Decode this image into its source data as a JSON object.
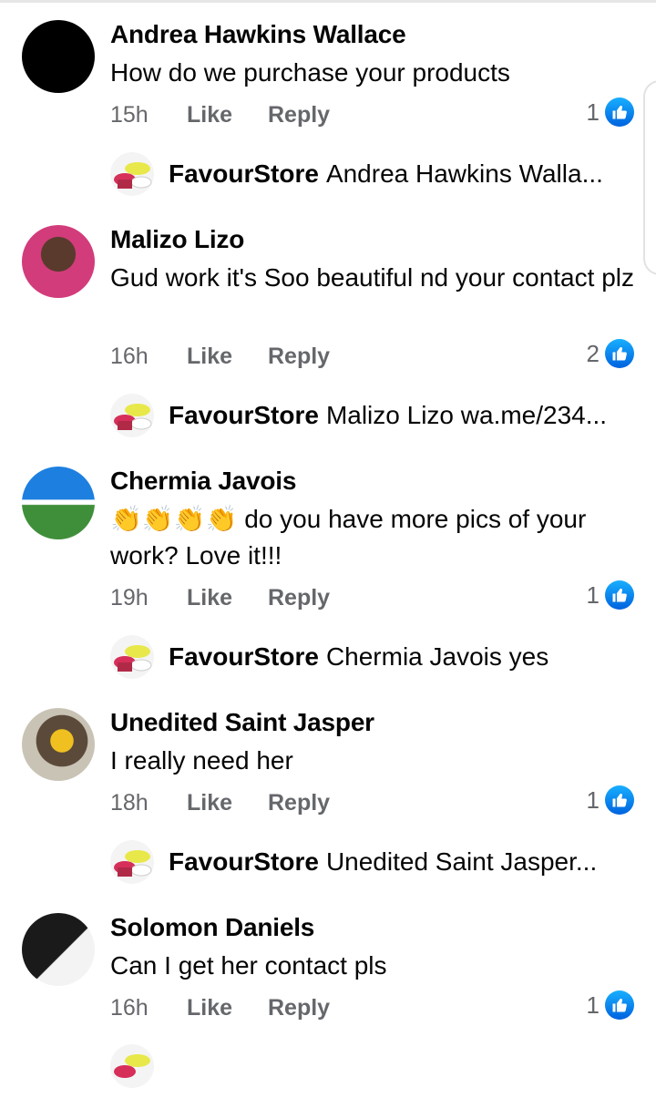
{
  "comments": [
    {
      "author": "Andrea Hawkins Wallace",
      "text": "How do we purchase your products",
      "time": "15h",
      "like": "Like",
      "reply": "Reply",
      "reactions": "1",
      "reply_author": "FavourStore",
      "reply_text": "Andrea Hawkins Walla..."
    },
    {
      "author": "Malizo Lizo",
      "text": "Gud work it's Soo beautiful nd your contact plz",
      "time": "16h",
      "like": "Like",
      "reply": "Reply",
      "reactions": "2",
      "reply_author": "FavourStore",
      "reply_text": "Malizo Lizo wa.me/234..."
    },
    {
      "author": "Chermia Javois",
      "text": "👏👏👏👏 do you have more pics of your work? Love it!!!",
      "time": "19h",
      "like": "Like",
      "reply": "Reply",
      "reactions": "1",
      "reply_author": "FavourStore",
      "reply_text": "Chermia Javois yes"
    },
    {
      "author": "Unedited Saint Jasper",
      "text": "I really need her",
      "time": "18h",
      "like": "Like",
      "reply": "Reply",
      "reactions": "1",
      "reply_author": "FavourStore",
      "reply_text": "Unedited Saint Jasper..."
    },
    {
      "author": "Solomon Daniels",
      "text": "Can I get her contact pls",
      "time": "16h",
      "like": "Like",
      "reply": "Reply",
      "reactions": "1"
    }
  ],
  "colors": {
    "like_blue": "#1877f2",
    "meta_grey": "#65676b"
  },
  "icons": {
    "reaction": "like-thumb-icon"
  }
}
